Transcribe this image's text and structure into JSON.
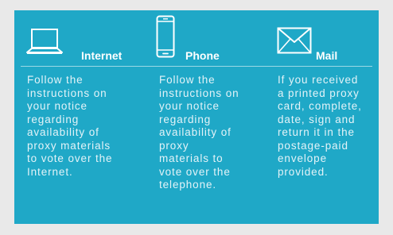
{
  "colors": {
    "panel_background": "#1fa8c7",
    "page_background": "#e9e9e9",
    "heading_text": "#ffffff",
    "body_text": "#e3f3f8"
  },
  "methods": [
    {
      "label": "Internet",
      "icon": "laptop-icon",
      "lines": [
        "Follow the",
        "instructions on",
        "your notice",
        "regarding",
        "availability of",
        "proxy materials",
        "to vote over the",
        "Internet."
      ]
    },
    {
      "label": "Phone",
      "icon": "smartphone-icon",
      "lines": [
        "Follow the",
        "instructions on",
        "your notice",
        "regarding",
        "availability of",
        "proxy",
        "materials to",
        "vote over the",
        "telephone."
      ]
    },
    {
      "label": "Mail",
      "icon": "envelope-icon",
      "lines": [
        "If you received",
        "a printed proxy",
        "card, complete,",
        "date, sign and",
        "return it in the",
        "postage-paid",
        "envelope",
        "provided."
      ]
    }
  ]
}
